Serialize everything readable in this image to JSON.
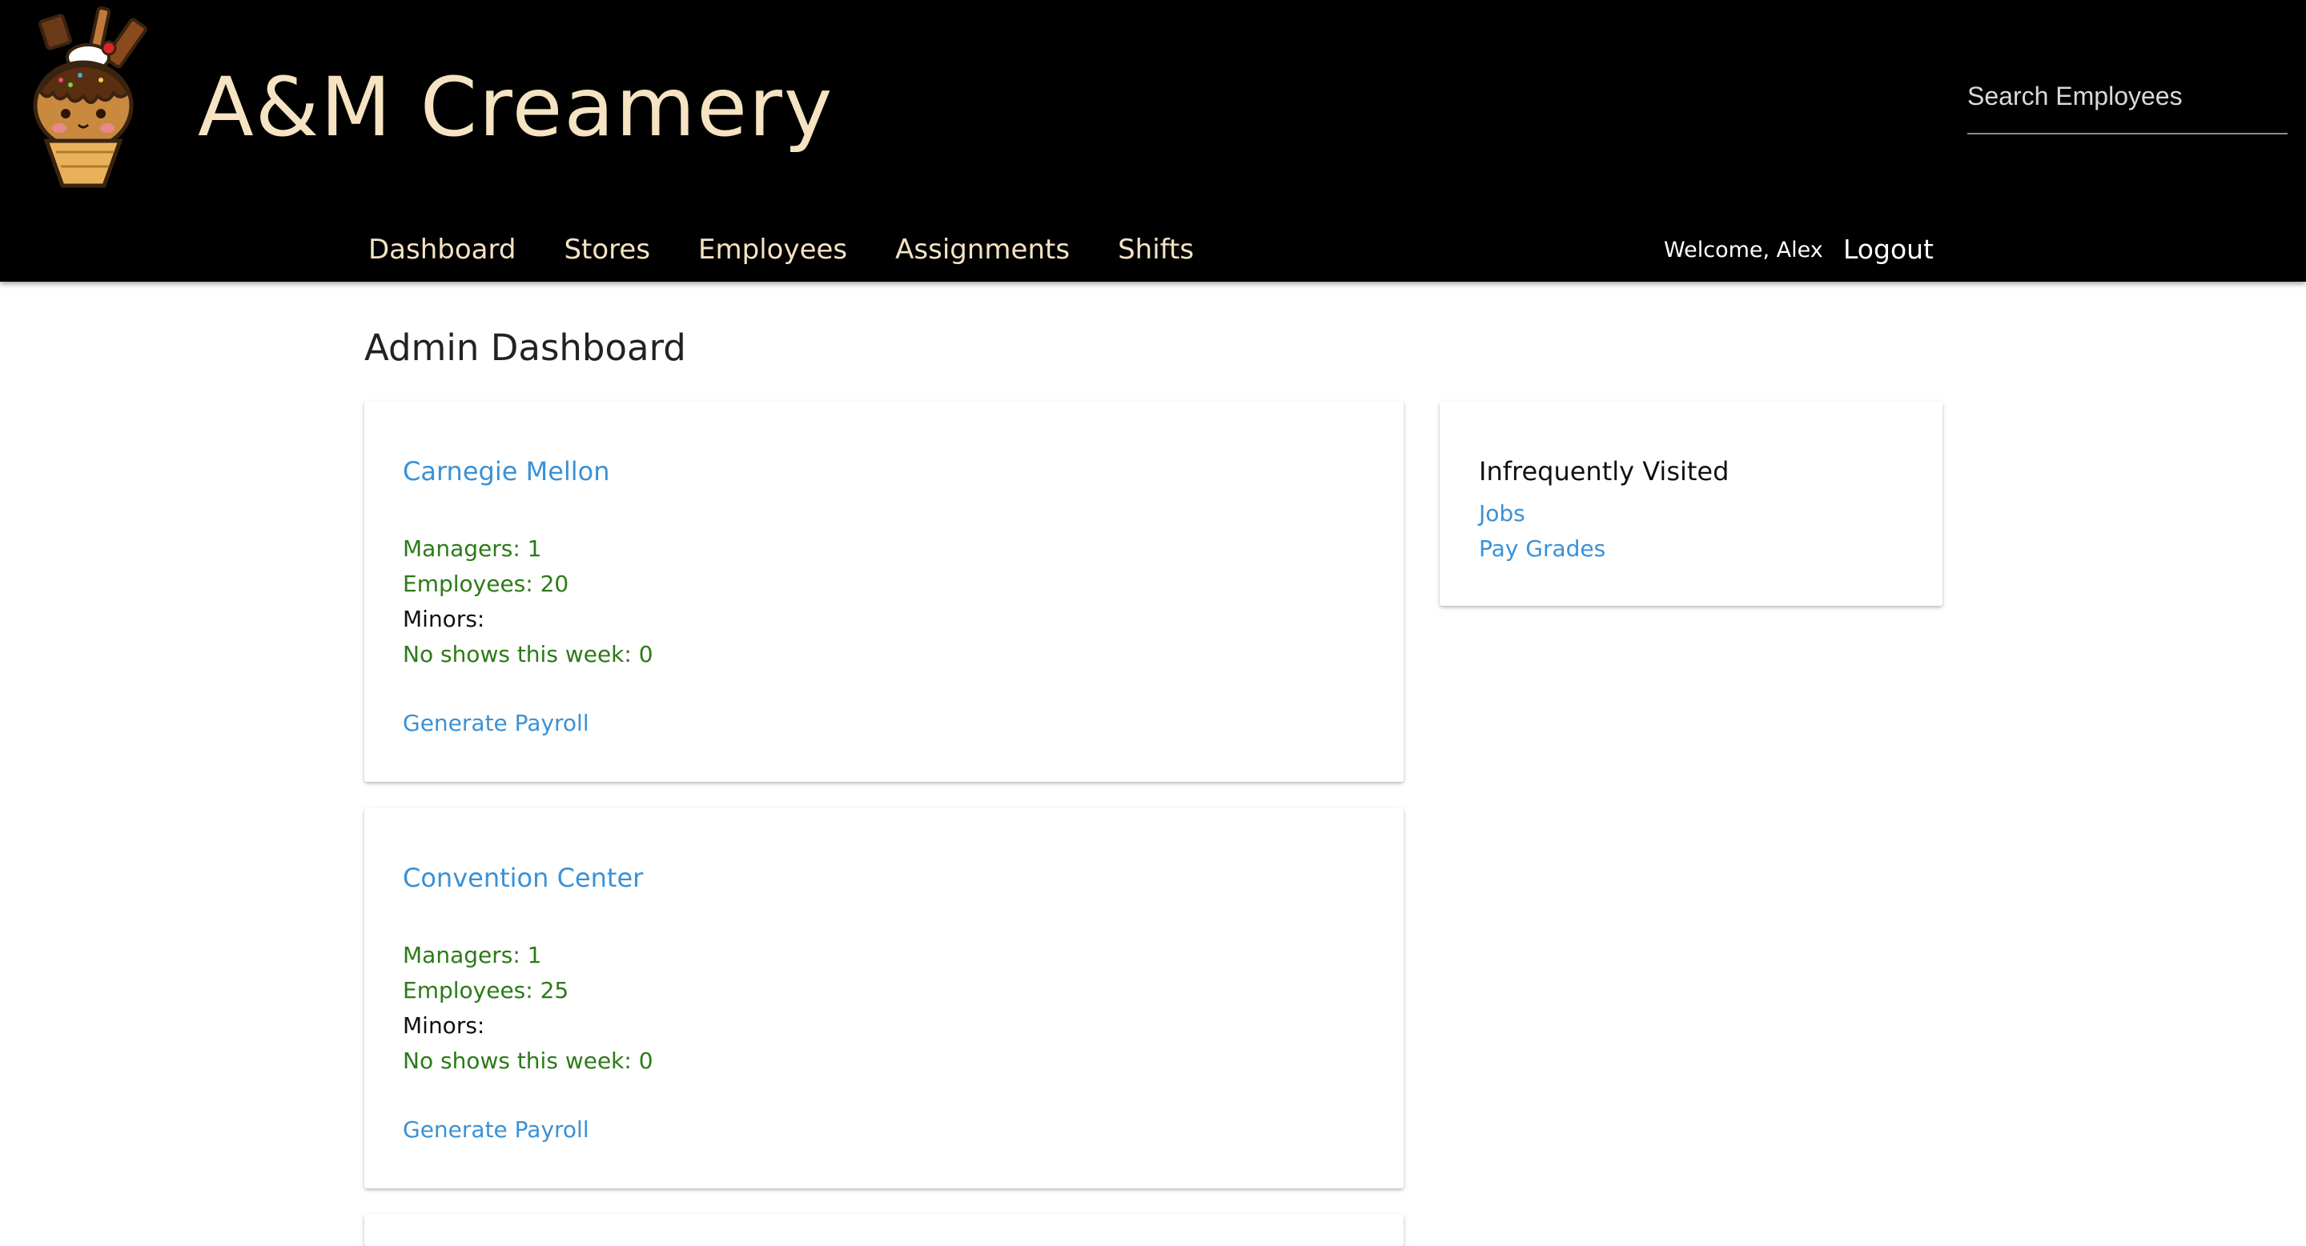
{
  "header": {
    "brand": "A&M Creamery",
    "search_placeholder": "Search Employees",
    "welcome": "Welcome, Alex",
    "logout": "Logout",
    "colors": {
      "background": "#000000",
      "brand": "#f5e3c2",
      "link": "#3a91d6",
      "stat_green": "#2c7a18"
    },
    "logo_icon": "ice-cream-sundae-logo"
  },
  "nav": {
    "items": [
      {
        "label": "Dashboard"
      },
      {
        "label": "Stores"
      },
      {
        "label": "Employees"
      },
      {
        "label": "Assignments"
      },
      {
        "label": "Shifts"
      }
    ]
  },
  "main": {
    "title": "Admin Dashboard",
    "stores": [
      {
        "name": "Carnegie Mellon",
        "managers": "Managers: 1",
        "employees": "Employees: 20",
        "minors": "Minors:",
        "no_shows": "No shows this week: 0",
        "payroll": "Generate Payroll"
      },
      {
        "name": "Convention Center",
        "managers": "Managers: 1",
        "employees": "Employees: 25",
        "minors": "Minors:",
        "no_shows": "No shows this week: 0",
        "payroll": "Generate Payroll"
      }
    ]
  },
  "sidebar": {
    "title": "Infrequently Visited",
    "links": [
      {
        "label": "Jobs"
      },
      {
        "label": "Pay Grades"
      }
    ]
  }
}
